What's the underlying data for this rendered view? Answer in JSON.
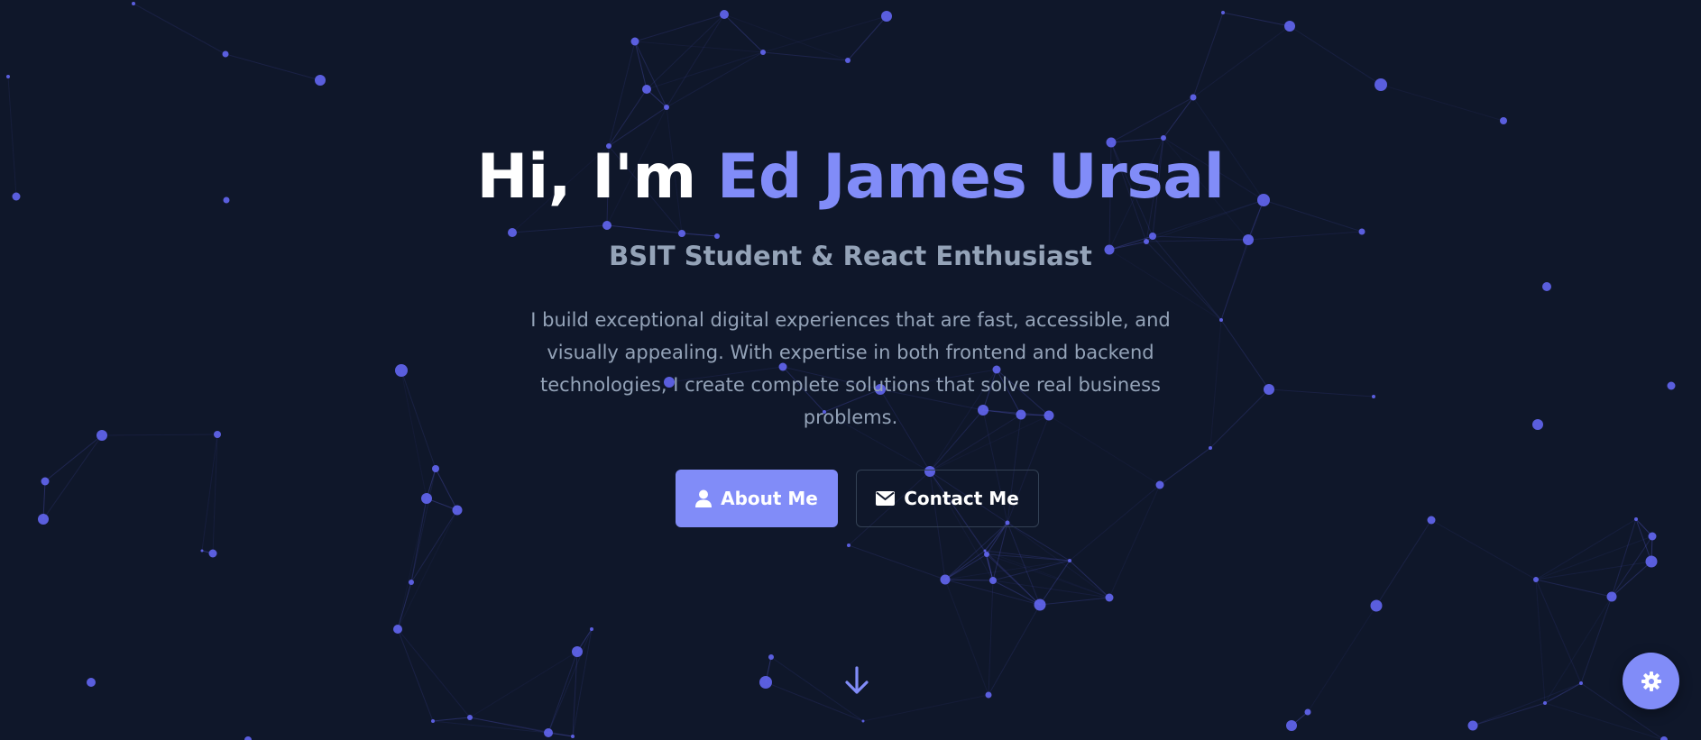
{
  "hero": {
    "title_prefix": "Hi, I'm ",
    "title_name": "Ed James Ursal",
    "subtitle": "BSIT Student & React Enthusiast",
    "bio": "I build exceptional digital experiences that are fast, accessible, and visually appealing. With expertise in both frontend and backend technologies, I create complete solutions that solve real business problems.",
    "about_button": {
      "label": "About Me",
      "icon": "user-icon"
    },
    "contact_button": {
      "label": "Contact Me",
      "icon": "envelope-icon"
    },
    "scroll_icon": "arrow-down-icon"
  },
  "settings_button": {
    "icon": "gear-icon"
  },
  "theme": {
    "background": "#0f172a",
    "accent": "#818cf8",
    "node": "#6366f1",
    "text_primary": "#ffffff",
    "text_muted": "#94a3b8",
    "border": "#334155"
  }
}
